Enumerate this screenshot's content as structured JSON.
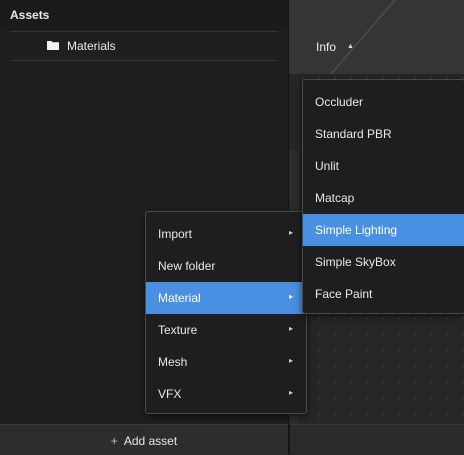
{
  "assets": {
    "title": "Assets",
    "tree": [
      {
        "label": "Materials",
        "icon": "folder-icon"
      }
    ],
    "add_asset": {
      "plus": "+",
      "label": "Add asset"
    }
  },
  "info": {
    "label": "Info",
    "caret": "▲"
  },
  "context_menu": {
    "items": [
      {
        "label": "Import",
        "has_submenu": true,
        "arrow": "▸"
      },
      {
        "label": "New folder",
        "has_submenu": false,
        "arrow": ""
      },
      {
        "label": "Material",
        "has_submenu": true,
        "arrow": "▸",
        "active": true
      },
      {
        "label": "Texture",
        "has_submenu": true,
        "arrow": "▸"
      },
      {
        "label": "Mesh",
        "has_submenu": true,
        "arrow": "▸"
      },
      {
        "label": "VFX",
        "has_submenu": true,
        "arrow": "▸"
      }
    ]
  },
  "material_submenu": {
    "items": [
      {
        "label": "Occluder"
      },
      {
        "label": "Standard PBR"
      },
      {
        "label": "Unlit"
      },
      {
        "label": "Matcap"
      },
      {
        "label": "Simple Lighting",
        "active": true
      },
      {
        "label": "Simple SkyBox"
      },
      {
        "label": "Face Paint"
      }
    ]
  },
  "colors": {
    "accent": "#4a90e2",
    "panel": "#1f1f1f",
    "menu": "#1e1e1e"
  }
}
